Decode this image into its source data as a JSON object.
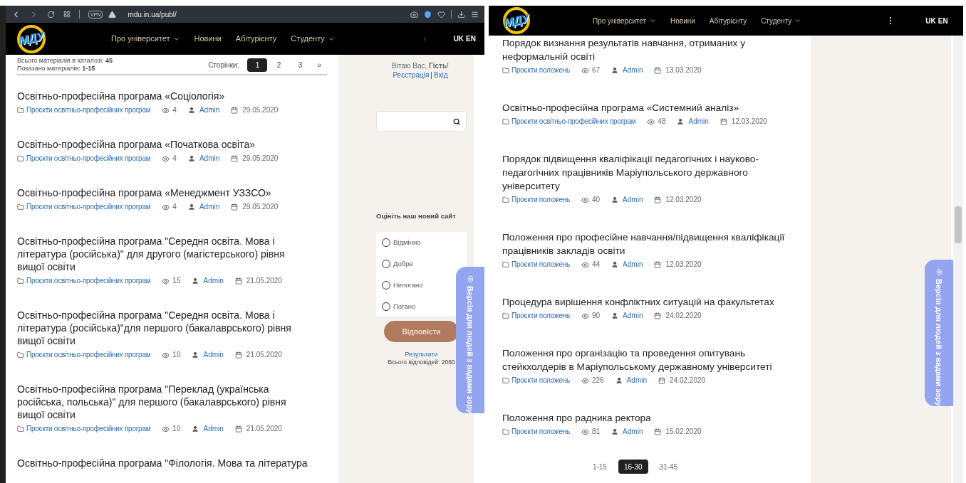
{
  "left_window": {
    "browser": {
      "vpn": "VPN",
      "url": "mdu.in.ua/publ/"
    },
    "header": {
      "logo_text": "МДУ",
      "nav": [
        {
          "label": "Про університет",
          "dropdown": true
        },
        {
          "label": "Новини",
          "dropdown": false
        },
        {
          "label": "Абітурієнту",
          "dropdown": false
        },
        {
          "label": "Студенту",
          "dropdown": true
        }
      ],
      "languages": [
        "UK",
        "EN"
      ]
    },
    "catalog_info": {
      "total": "Всього матеріалів в каталозі: **45**",
      "shown": "Показано матеріалів: **1-15**"
    },
    "pagination": {
      "label": "Сторінки:",
      "pages": [
        {
          "label": "1",
          "selected": true
        },
        {
          "label": "2",
          "selected": false
        },
        {
          "label": "3",
          "selected": false
        }
      ],
      "next": "»"
    },
    "items": [
      {
        "title": "Освітньо-професійна програма «Соціологія»",
        "category": "Проєкти освітньо-професійних програм",
        "views": "4",
        "author": "Admin",
        "date": "29.05.2020"
      },
      {
        "title": "Освітньо-професійна програма «Початкова освіта»",
        "category": "Проєкти освітньо-професійних програм",
        "views": "4",
        "author": "Admin",
        "date": "29.05.2020"
      },
      {
        "title": "Освітньо-професійна програма «Менеджмент УЗЗСО»",
        "category": "Проєкти освітньо-професійних програм",
        "views": "4",
        "author": "Admin",
        "date": "29.05.2020"
      },
      {
        "title": "Освітньо-професійна програма \"Середня освіта. Мова і література (російська)\" для другого (магістерського) рівня вищої освіти",
        "category": "Проєкти освітньо-професійних програм",
        "views": "15",
        "author": "Admin",
        "date": "21.05.2020"
      },
      {
        "title": "Освітньо-професійна програма \"Середня освіта. Мова і література (російська)\"для першого (бакалаврського) рівня вищої освіти",
        "category": "Проєкти освітньо-професійних програм",
        "views": "10",
        "author": "Admin",
        "date": "21.05.2020"
      },
      {
        "title": "Освітньо-професійна програма \"Переклад (українська російська, польська)\" для першого (бакалаврського) рівня вищої освіти",
        "category": "Проєкти освітньо-професійних програм",
        "views": "10",
        "author": "Admin",
        "date": "21.05.2020"
      },
      {
        "title": "Освітньо-професійна програма \"Філологія. Мова та література"
      }
    ],
    "sidebar": {
      "greeting": "Вітаю Вас, **Гість**!",
      "register": "Реєстрація",
      "separator": "|",
      "login": "Вхід",
      "poll": {
        "title": "Оцініть наш новий сайт",
        "options": [
          {
            "label": "Відмінно",
            "selected": false
          },
          {
            "label": "Добре",
            "selected": false
          },
          {
            "label": "Непогано",
            "selected": false
          },
          {
            "label": "Погано",
            "selected": false
          }
        ],
        "button": "Відповісти",
        "results": "Результати",
        "total": "Всього відповідей: 2080"
      }
    },
    "accessibility_tab": "Версія для людей з вадами зору"
  },
  "right_window": {
    "header": {
      "logo_text": "МДУ",
      "nav": [
        {
          "label": "Про університет",
          "dropdown": true
        },
        {
          "label": "Новини",
          "dropdown": false
        },
        {
          "label": "Абітурієнту",
          "dropdown": false
        },
        {
          "label": "Студенту",
          "dropdown": true
        }
      ],
      "languages": [
        "UK",
        "EN"
      ]
    },
    "items": [
      {
        "title": "Порядок визнання результатів навчання, отриманих у неформальній освіті",
        "category": "Проєкти положень",
        "views": "67",
        "author": "Admin",
        "date": "13.03.2020"
      },
      {
        "title": "Освітньо-професійна програма «Системний аналіз»",
        "category": "Проєкти освітньо-професійних програм",
        "views": "48",
        "author": "Admin",
        "date": "12.03.2020"
      },
      {
        "title": "Порядок підвищення кваліфікації педагогічних і науково-педагогічних працівників Маріупольського державного університету",
        "category": "Проєкти положень",
        "views": "40",
        "author": "Admin",
        "date": "12.03.2020"
      },
      {
        "title": "Положення про професійне навчання/підвищення кваліфікації працівників закладів освіти",
        "category": "Проєкти положень",
        "views": "44",
        "author": "Admin",
        "date": "12.03.2020"
      },
      {
        "title": "Процедура вирішення конфліктних ситуацій на факультетах",
        "category": "Проєкти положень",
        "views": "90",
        "author": "Admin",
        "date": "24.02.2020"
      },
      {
        "title": "Положення про організацію та проведення опитувань стейкхолдерів в Маріупольському державному університеті",
        "category": "Проєкти положень",
        "views": "226",
        "author": "Admin",
        "date": "24.02.2020"
      },
      {
        "title": "Положення про радника ректора",
        "category": "Проєкти положень",
        "views": "81",
        "author": "Admin",
        "date": "15.02.2020"
      }
    ],
    "pagination": [
      {
        "label": "1-15",
        "selected": false
      },
      {
        "label": "16-30",
        "selected": true
      },
      {
        "label": "31-45",
        "selected": false
      }
    ],
    "accessibility_tab": "Версія для людей з вадами зору"
  }
}
